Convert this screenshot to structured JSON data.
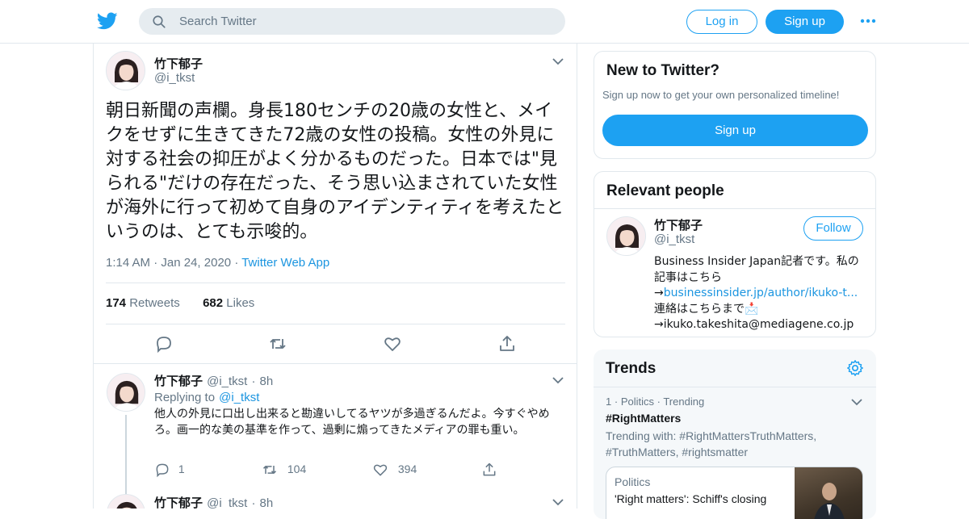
{
  "topbar": {
    "search_placeholder": "Search Twitter",
    "login_label": "Log in",
    "signup_label": "Sign up",
    "brand_color": "#1da1f2"
  },
  "tweet": {
    "author_name": "竹下郁子",
    "author_handle": "@i_tkst",
    "text": "朝日新聞の声欄。身長180センチの20歳の女性と、メイクをせずに生きてきた72歳の女性の投稿。女性の外見に対する社会の抑圧がよく分かるものだった。日本では\"見られる\"だけの存在だった、そう思い込まされていた女性が海外に行って初めて自身のアイデンティティを考えたというのは、とても示唆的。",
    "time": "1:14 AM",
    "date": "Jan 24, 2020",
    "source": "Twitter Web App",
    "retweets_count": "174",
    "retweets_label": "Retweets",
    "likes_count": "682",
    "likes_label": "Likes"
  },
  "replies": [
    {
      "author_name": "竹下郁子",
      "author_handle": "@i_tkst",
      "age": "8h",
      "replying_prefix": "Replying to",
      "replying_to": "@i_tkst",
      "text": "他人の外見に口出し出来ると勘違いしてるヤツが多過ぎるんだよ。今すぐやめろ。画一的な美の基準を作って、過剰に煽ってきたメディアの罪も重い。",
      "reply_count": "1",
      "retweet_count": "104",
      "like_count": "394"
    },
    {
      "author_name": "竹下郁子",
      "author_handle": "@i_tkst",
      "age": "8h"
    }
  ],
  "new_to_twitter": {
    "title": "New to Twitter?",
    "subtitle": "Sign up now to get your own personalized timeline!",
    "button_label": "Sign up"
  },
  "relevant_people": {
    "title": "Relevant people",
    "person": {
      "name": "竹下郁子",
      "handle": "@i_tkst",
      "follow_label": "Follow",
      "bio_part1": "Business Insider Japan記者です。私の記事はこちら",
      "bio_arrow1": "→",
      "bio_link": "businessinsider.jp/author/ikuko-t...",
      "bio_part2": " 連絡はこちらまで📩",
      "bio_arrow2": "→",
      "bio_email": "ikuko.takeshita@mediagene.co.jp"
    }
  },
  "trends": {
    "title": "Trends",
    "items": [
      {
        "rank": "1",
        "category": "Politics",
        "status": "Trending",
        "name": "#RightMatters",
        "trending_with": "Trending with: #RightMattersTruthMatters, #TruthMatters, #rightsmatter",
        "story_category": "Politics",
        "story_headline": "'Right matters': Schiff's closing"
      }
    ]
  }
}
